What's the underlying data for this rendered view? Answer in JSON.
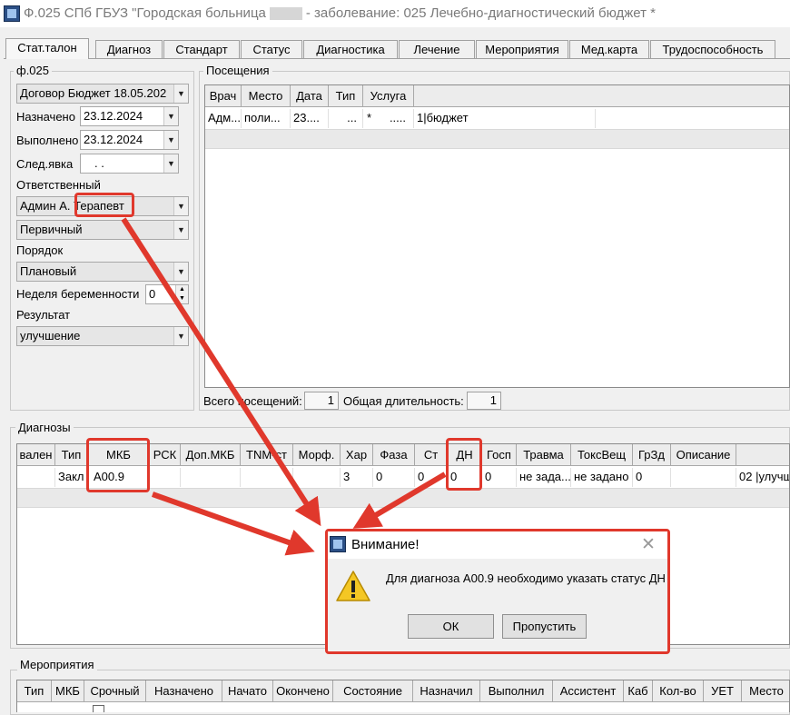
{
  "window": {
    "title_prefix": "Ф.025 СПб ГБУЗ \"Городская больница",
    "title_suffix": "- заболевание: 025 Лечебно-диагностический бюджет *"
  },
  "tabs": [
    "Стат.талон",
    "Диагноз",
    "Стандарт",
    "Статус",
    "Диагностика",
    "Лечение",
    "Мероприятия",
    "Мед.карта",
    "Трудоспособность"
  ],
  "f025": {
    "group": "ф.025",
    "contract": "Договор Бюджет 18.05.202",
    "assigned_label": "Назначено",
    "assigned": "23.12.2024",
    "done_label": "Выполнено",
    "done": "23.12.2024",
    "next_label": "След.явка",
    "next": ". .",
    "responsible_label": "Ответственный",
    "responsible": "Админ А. Терапевт",
    "visit_type": "Первичный",
    "order_label": "Порядок",
    "order": "Плановый",
    "pregnancy_label": "Неделя беременности",
    "pregnancy": "0",
    "result_label": "Результат",
    "result": "улучшение"
  },
  "visits": {
    "group": "Посещения",
    "columns": [
      "Врач",
      "Место",
      "Дата",
      "Тип",
      "Услуга"
    ],
    "row": [
      "Адм...",
      "поли...",
      "23....",
      "...",
      "*",
      ".....",
      "1|бюджет"
    ],
    "total_label": "Всего посещений:",
    "total": "1",
    "duration_label": "Общая длительность:",
    "duration": "1"
  },
  "diagnoses": {
    "group": "Диагнозы",
    "columns": [
      "вален",
      "Тип",
      "МКБ",
      "РСК",
      "Доп.МКБ",
      "TNM-ст",
      "Морф.",
      "Хар",
      "Фаза",
      "Ст",
      "ДН",
      "Госп",
      "Травма",
      "ТоксВещ",
      "ГрЗд",
      "Описание"
    ],
    "row": [
      "",
      "Закл",
      "A00.9",
      "",
      "",
      "",
      "",
      "3",
      "0",
      "0",
      "0",
      "0",
      "не зада...",
      "не задано",
      "0",
      "",
      "02 |улучш"
    ]
  },
  "events": {
    "group": "Мероприятия",
    "columns": [
      "Тип",
      "МКБ",
      "Срочный",
      "Назначено",
      "Начато",
      "Окончено",
      "Состояние",
      "Назначил",
      "Выполнил",
      "Ассистент",
      "Каб",
      "Кол-во",
      "УЕТ",
      "Место"
    ]
  },
  "dialog": {
    "title": "Внимание!",
    "message": "Для диагноза A00.9 необходимо указать статус ДН",
    "ok": "ОК",
    "skip": "Пропустить"
  },
  "colors": {
    "annotation": "#e0382c",
    "grid_header": "#ececec",
    "selected_row": "#e9e9e9"
  }
}
